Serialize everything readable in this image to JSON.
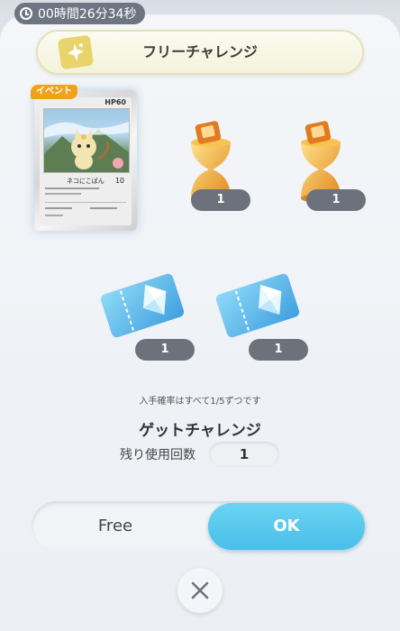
{
  "timer": {
    "text": "00時間26分34秒",
    "icon": "clock-icon"
  },
  "header": {
    "title": "フリーチャレンジ",
    "icon": "sparkle-card-icon"
  },
  "card": {
    "badge": "イベント",
    "hp": "HP60",
    "move": "ネコにこばん",
    "damage": "10"
  },
  "rewards": [
    {
      "icon": "hourglass-icon",
      "count": "1"
    },
    {
      "icon": "hourglass-icon",
      "count": "1"
    },
    {
      "icon": "ticket-icon",
      "count": "1"
    },
    {
      "icon": "ticket-icon",
      "count": "1"
    }
  ],
  "note": "入手確率はすべて1/5ずつです",
  "get_challenge": {
    "title": "ゲットチャレンジ",
    "remaining_label": "残り使用回数",
    "remaining_value": "1"
  },
  "toggle": {
    "free_label": "Free",
    "ok_label": "OK"
  },
  "colors": {
    "accent": "#48bfe9",
    "pill": "#6c717c",
    "badge": "#f0a21a"
  }
}
